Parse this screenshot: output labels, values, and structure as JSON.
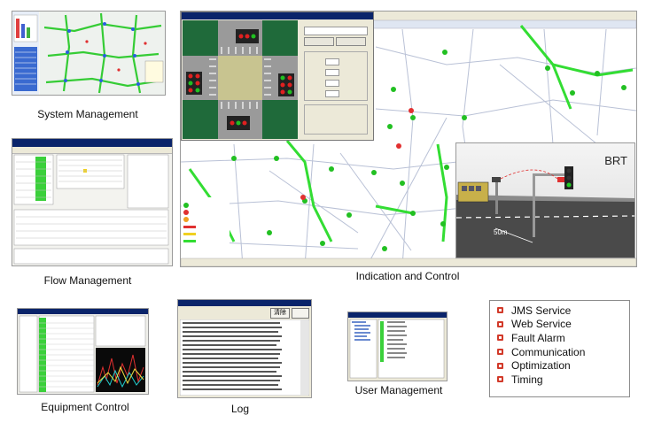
{
  "panels": {
    "system_management": {
      "caption": "System Management"
    },
    "flow_management": {
      "caption": "Flow Management"
    },
    "indication_control": {
      "caption": "Indication and  Control",
      "brt_label": "BRT",
      "distance_label": "50m"
    },
    "equipment_control": {
      "caption": "Equipment Control"
    },
    "log": {
      "caption": "Log",
      "button": "清除"
    },
    "user_management": {
      "caption": "User Management"
    }
  },
  "features": [
    {
      "label": "JMS Service",
      "icon": "red-bullet-icon"
    },
    {
      "label": "Web Service",
      "icon": "red-bullet-icon"
    },
    {
      "label": "Fault Alarm",
      "icon": "red-bullet-icon"
    },
    {
      "label": "Communication",
      "icon": "red-bullet-icon"
    },
    {
      "label": "Optimization",
      "icon": "red-bullet-icon"
    },
    {
      "label": "Timing",
      "icon": "red-bullet-icon"
    }
  ],
  "colors": {
    "map_road": "#33dd33",
    "alert": "#d23a2a",
    "title_bar": "#0a246a",
    "window_bg": "#ece9d8"
  }
}
